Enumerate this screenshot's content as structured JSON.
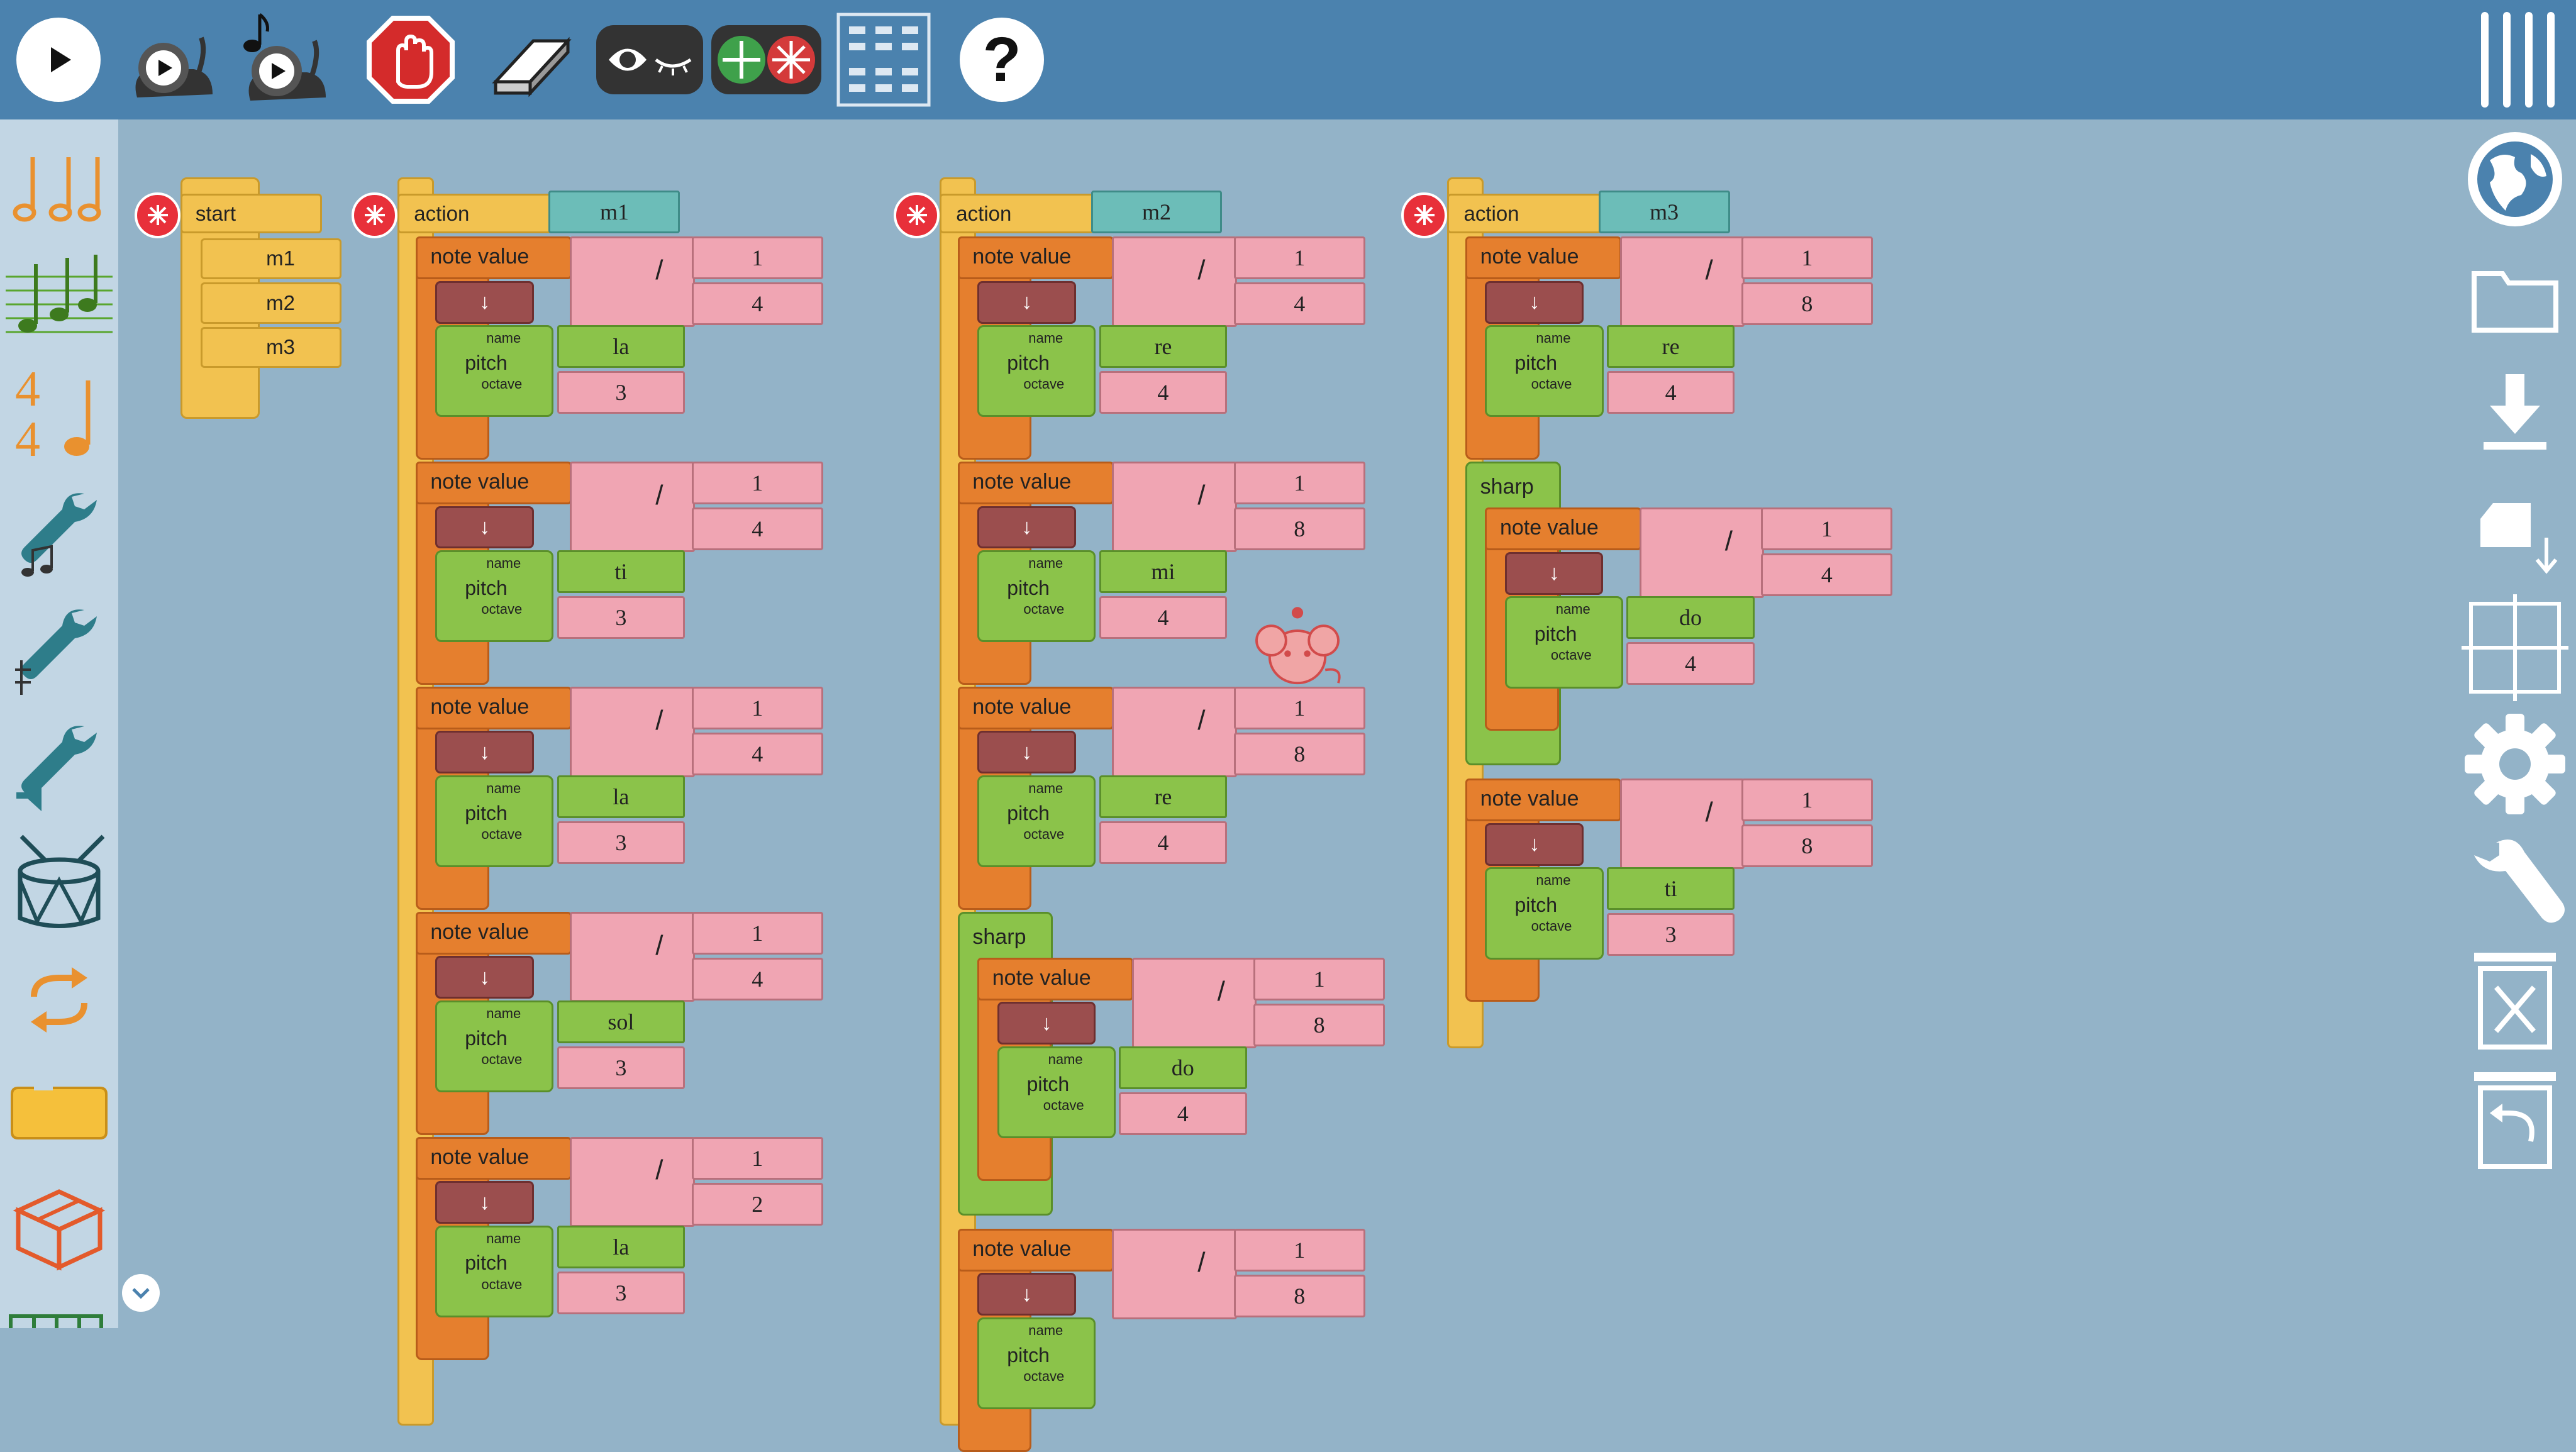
{
  "toolbar": {
    "buttons": [
      {
        "name": "play-button",
        "icon": "play-icon"
      },
      {
        "name": "play-slow-button",
        "icon": "snail-play-icon"
      },
      {
        "name": "play-music-slow-button",
        "icon": "snail-note-play-icon"
      },
      {
        "name": "stop-button",
        "icon": "stop-hand-icon"
      },
      {
        "name": "clean-button",
        "icon": "eraser-icon"
      },
      {
        "name": "show-hide-button",
        "icon": "eye-icon"
      },
      {
        "name": "collapse-expand-button",
        "icon": "expand-collapse-icon"
      },
      {
        "name": "palette-grid-button",
        "icon": "grid-icon"
      },
      {
        "name": "help-button",
        "icon": "question-icon",
        "label": "?"
      }
    ]
  },
  "sidebar": {
    "palettes": [
      "rhythm",
      "pitch",
      "meter",
      "tone",
      "ornament",
      "volume",
      "drum",
      "flow",
      "action",
      "extras"
    ],
    "meter_label": "4\n4"
  },
  "right_toolbar": {
    "buttons": [
      "globe-icon",
      "folder-icon",
      "download-icon",
      "save-file-icon",
      "grid-crosshair-icon",
      "gear-icon",
      "wrench-icon",
      "delete-icon",
      "restore-icon"
    ]
  },
  "blocks": {
    "start": {
      "label": "start",
      "items": [
        "m1",
        "m2",
        "m3"
      ]
    },
    "labels": {
      "action": "action",
      "note_value": "note value",
      "pitch": "pitch",
      "name": "name",
      "octave": "octave",
      "sharp": "sharp",
      "divide": "/",
      "down_arrow": "↓"
    },
    "stacks": [
      {
        "name": "m1",
        "notes": [
          {
            "num": "1",
            "den": "4",
            "pitch": "la",
            "octave": "3"
          },
          {
            "num": "1",
            "den": "4",
            "pitch": "ti",
            "octave": "3"
          },
          {
            "num": "1",
            "den": "4",
            "pitch": "la",
            "octave": "3"
          },
          {
            "num": "1",
            "den": "4",
            "pitch": "sol",
            "octave": "3"
          },
          {
            "num": "1",
            "den": "2",
            "pitch": "la",
            "octave": "3"
          }
        ]
      },
      {
        "name": "m2",
        "notes": [
          {
            "num": "1",
            "den": "4",
            "pitch": "re",
            "octave": "4"
          },
          {
            "num": "1",
            "den": "8",
            "pitch": "mi",
            "octave": "4"
          },
          {
            "num": "1",
            "den": "8",
            "pitch": "re",
            "octave": "4"
          },
          {
            "num": "1",
            "den": "8",
            "pitch": "do",
            "octave": "4",
            "sharp": true
          },
          {
            "num": "1",
            "den": "8",
            "pitch": "",
            "octave": ""
          }
        ]
      },
      {
        "name": "m3",
        "notes": [
          {
            "num": "1",
            "den": "8",
            "pitch": "re",
            "octave": "4"
          },
          {
            "num": "1",
            "den": "4",
            "pitch": "do",
            "octave": "4",
            "sharp": true
          },
          {
            "num": "1",
            "den": "8",
            "pitch": "ti",
            "octave": "3"
          }
        ]
      }
    ]
  },
  "colors": {
    "topbar": "#4b82ae",
    "canvas": "#93b3c8",
    "sidebar": "#c2d6e4",
    "action_yellow": "#f2c250",
    "note_orange": "#e57f2e",
    "pitch_green": "#8bc34a",
    "number_pink": "#f0a5b3",
    "name_teal": "#6cbdb8",
    "arrow_brown": "#9b4e4e"
  }
}
